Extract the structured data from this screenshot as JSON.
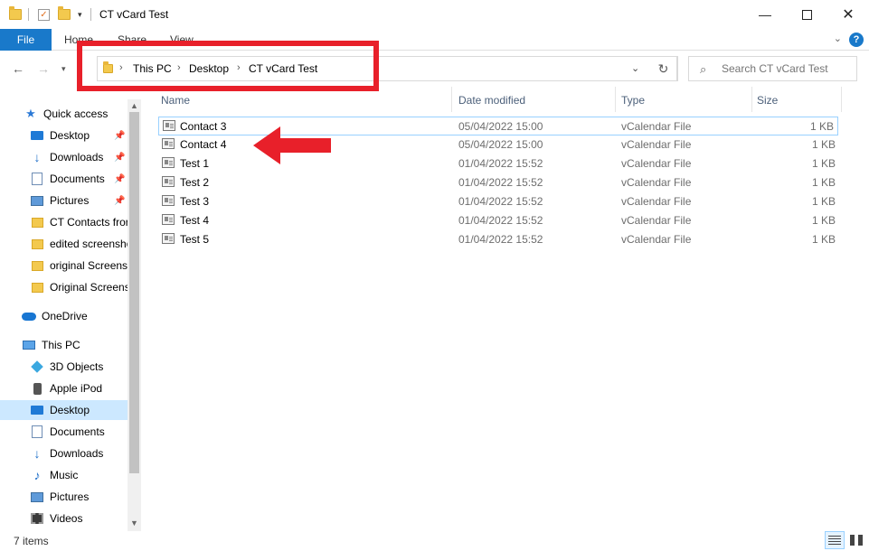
{
  "window": {
    "title": "CT vCard Test",
    "minimize_icon": "minimize-icon",
    "maximize_icon": "maximize-icon",
    "close_icon": "close-icon"
  },
  "ribbon": {
    "file": "File",
    "tabs": [
      "Home",
      "Share",
      "View"
    ]
  },
  "address": {
    "crumbs": [
      "This PC",
      "Desktop",
      "CT vCard Test"
    ]
  },
  "search": {
    "placeholder": "Search CT vCard Test"
  },
  "sidebar": {
    "items": [
      {
        "label": "Quick access",
        "icon": "star-icon"
      },
      {
        "label": "Desktop",
        "icon": "desktop-icon",
        "pinned": true
      },
      {
        "label": "Downloads",
        "icon": "download-icon",
        "pinned": true
      },
      {
        "label": "Documents",
        "icon": "documents-icon",
        "pinned": true
      },
      {
        "label": "Pictures",
        "icon": "pictures-icon",
        "pinned": true
      },
      {
        "label": "CT Contacts fror",
        "icon": "folder-icon"
      },
      {
        "label": "edited screensho",
        "icon": "folder-icon"
      },
      {
        "label": "original Screensh",
        "icon": "folder-icon"
      },
      {
        "label": "Original Screens",
        "icon": "folder-icon"
      },
      {
        "label": "OneDrive",
        "icon": "cloud-icon"
      },
      {
        "label": "This PC",
        "icon": "computer-icon"
      },
      {
        "label": "3D Objects",
        "icon": "3d-objects-icon"
      },
      {
        "label": "Apple iPod",
        "icon": "ipod-icon"
      },
      {
        "label": "Desktop",
        "icon": "desktop-icon",
        "selected": true
      },
      {
        "label": "Documents",
        "icon": "documents-icon"
      },
      {
        "label": "Downloads",
        "icon": "download-icon"
      },
      {
        "label": "Music",
        "icon": "music-icon"
      },
      {
        "label": "Pictures",
        "icon": "pictures-icon"
      },
      {
        "label": "Videos",
        "icon": "videos-icon"
      }
    ]
  },
  "columns": {
    "name": "Name",
    "date": "Date modified",
    "type": "Type",
    "size": "Size"
  },
  "files": [
    {
      "name": "Contact 3",
      "date": "05/04/2022 15:00",
      "type": "vCalendar File",
      "size": "1 KB",
      "selected": true
    },
    {
      "name": "Contact 4",
      "date": "05/04/2022 15:00",
      "type": "vCalendar File",
      "size": "1 KB"
    },
    {
      "name": "Test 1",
      "date": "01/04/2022 15:52",
      "type": "vCalendar File",
      "size": "1 KB"
    },
    {
      "name": "Test 2",
      "date": "01/04/2022 15:52",
      "type": "vCalendar File",
      "size": "1 KB"
    },
    {
      "name": "Test 3",
      "date": "01/04/2022 15:52",
      "type": "vCalendar File",
      "size": "1 KB"
    },
    {
      "name": "Test 4",
      "date": "01/04/2022 15:52",
      "type": "vCalendar File",
      "size": "1 KB"
    },
    {
      "name": "Test 5",
      "date": "01/04/2022 15:52",
      "type": "vCalendar File",
      "size": "1 KB"
    }
  ],
  "status": {
    "count": "7 items"
  },
  "colors": {
    "accent": "#1979ca",
    "annotation": "#e8202a",
    "selection": "#cce8ff"
  }
}
